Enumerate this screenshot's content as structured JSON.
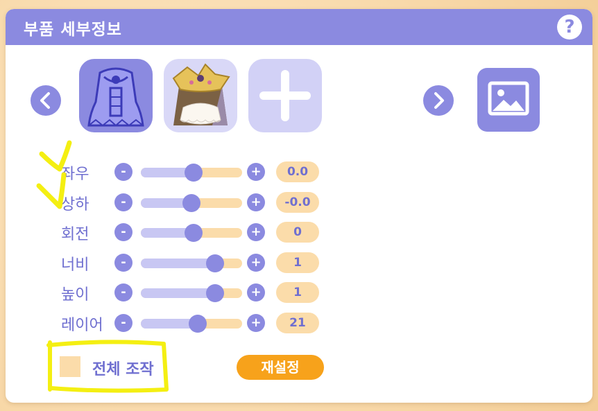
{
  "title": "부품 세부정보",
  "help_label": "?",
  "colors": {
    "accent": "#8b8ae0",
    "label": "#6f6fd0",
    "track_light": "#c8c7f3",
    "peach": "#fbdcaa",
    "orange": "#f7a21b",
    "highlighter": "#f4ef12"
  },
  "parts": [
    {
      "name": "robe-part-icon",
      "selected": true
    },
    {
      "name": "golden-headdress-part-icon",
      "selected": false
    },
    {
      "name": "add-part-icon",
      "selected": false
    }
  ],
  "sliders": [
    {
      "label": "좌우",
      "value": "0.0",
      "level": 0.52
    },
    {
      "label": "상하",
      "value": "-0.0",
      "level": 0.5
    },
    {
      "label": "회전",
      "value": "0",
      "level": 0.52
    },
    {
      "label": "너비",
      "value": "1",
      "level": 0.73
    },
    {
      "label": "높이",
      "value": "1",
      "level": 0.73
    },
    {
      "label": "레이어",
      "value": "21",
      "level": 0.56
    }
  ],
  "minus_label": "-",
  "plus_label": "+",
  "all_control_label": "전체 조작",
  "reset_label": "재설정"
}
